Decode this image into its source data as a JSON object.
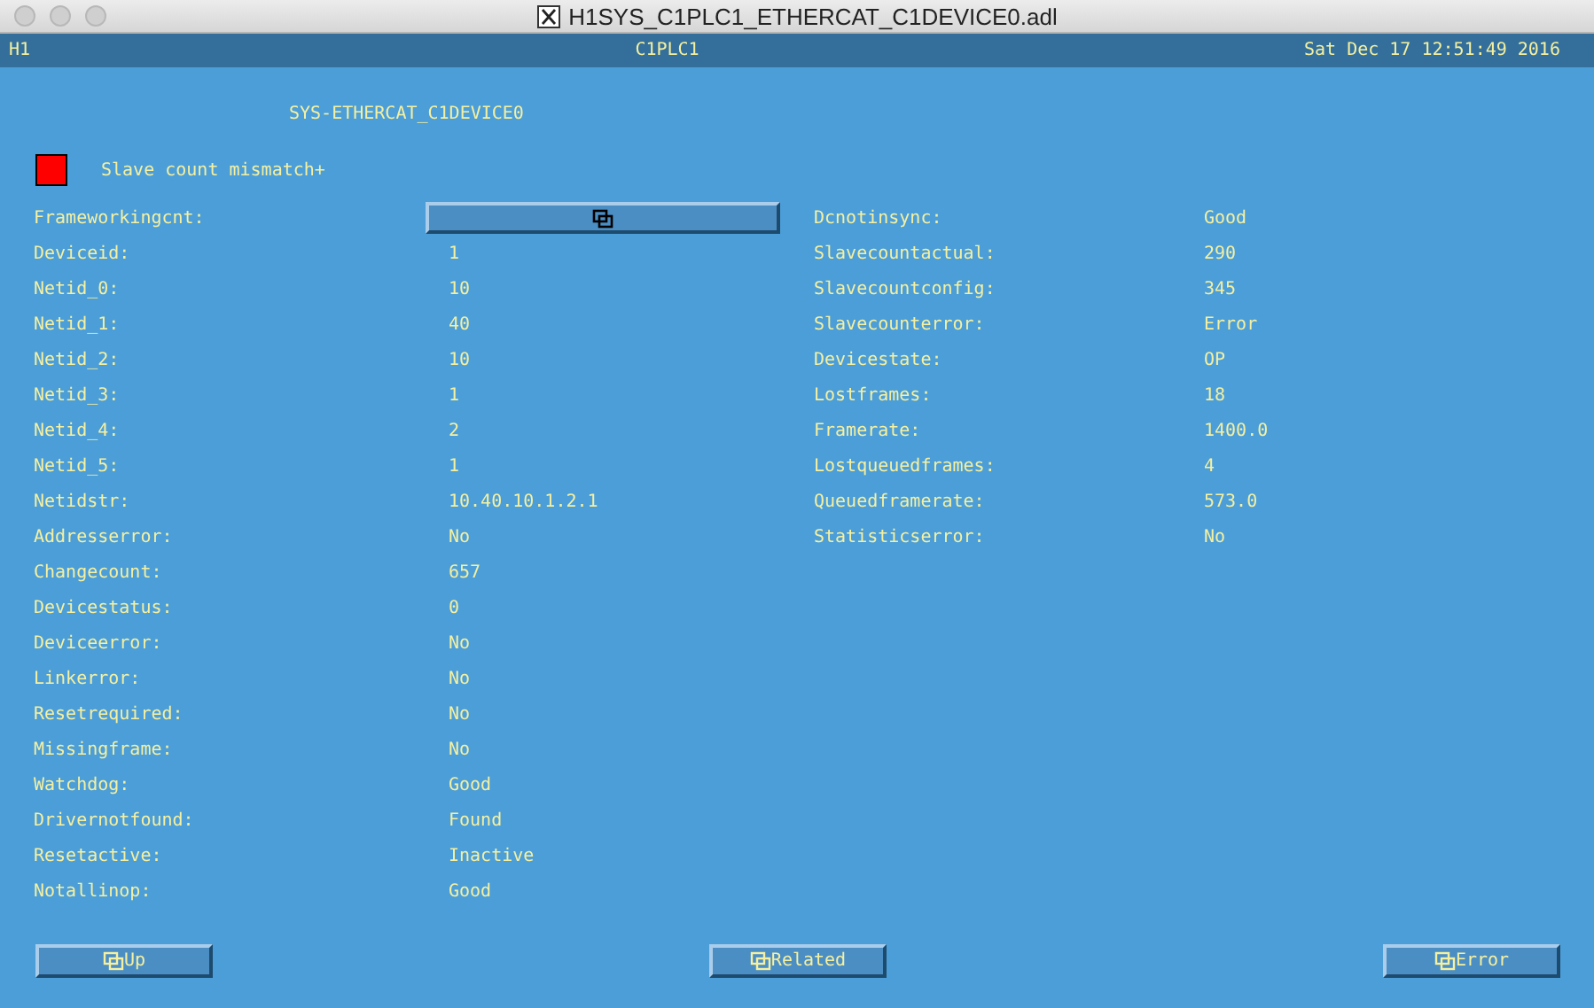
{
  "window": {
    "title": "H1SYS_C1PLC1_ETHERCAT_C1DEVICE0.adl"
  },
  "header": {
    "left": "H1",
    "center": "C1PLC1",
    "right": "Sat Dec 17 12:51:49 2016"
  },
  "screen_title": "SYS-ETHERCAT_C1DEVICE0",
  "alarm": {
    "color": "#ff0000",
    "text": "Slave count mismatch+"
  },
  "left_fields": [
    {
      "label": "Frameworkingcnt:",
      "kind": "button"
    },
    {
      "label": "Deviceid:",
      "value": "1",
      "kind": "text"
    },
    {
      "label": "Netid_0:",
      "value": "10",
      "kind": "text"
    },
    {
      "label": "Netid_1:",
      "value": "40",
      "kind": "text"
    },
    {
      "label": "Netid_2:",
      "value": "10",
      "kind": "text"
    },
    {
      "label": "Netid_3:",
      "value": "1",
      "kind": "text"
    },
    {
      "label": "Netid_4:",
      "value": "2",
      "kind": "text"
    },
    {
      "label": "Netid_5:",
      "value": "1",
      "kind": "text"
    },
    {
      "label": "Netidstr:",
      "value": "10.40.10.1.2.1",
      "kind": "text"
    },
    {
      "label": "Addresserror:",
      "value": "No",
      "kind": "text"
    },
    {
      "label": "Changecount:",
      "value": "657",
      "kind": "text"
    },
    {
      "label": "Devicestatus:",
      "value": "0",
      "kind": "text"
    },
    {
      "label": "Deviceerror:",
      "value": "No",
      "kind": "text"
    },
    {
      "label": "Linkerror:",
      "value": "No",
      "kind": "text"
    },
    {
      "label": "Resetrequired:",
      "value": "No",
      "kind": "text"
    },
    {
      "label": "Missingframe:",
      "value": "No",
      "kind": "text"
    },
    {
      "label": "Watchdog:",
      "value": "Good",
      "kind": "text"
    },
    {
      "label": "Drivernotfound:",
      "value": "Found",
      "kind": "text"
    },
    {
      "label": "Resetactive:",
      "value": "Inactive",
      "kind": "text"
    },
    {
      "label": "Notallinop:",
      "value": "Good",
      "kind": "text"
    }
  ],
  "right_fields": [
    {
      "label": "Dcnotinsync:",
      "value": "Good"
    },
    {
      "label": "Slavecountactual:",
      "value": "290"
    },
    {
      "label": "Slavecountconfig:",
      "value": "345"
    },
    {
      "label": "Slavecounterror:",
      "value": "Error"
    },
    {
      "label": "Devicestate:",
      "value": "OP"
    },
    {
      "label": "Lostframes:",
      "value": "18"
    },
    {
      "label": "Framerate:",
      "value": "1400.0"
    },
    {
      "label": "Lostqueuedframes:",
      "value": "4"
    },
    {
      "label": "Queuedframerate:",
      "value": "573.0"
    },
    {
      "label": "Statisticserror:",
      "value": "No"
    }
  ],
  "buttons": [
    {
      "label": "Up"
    },
    {
      "label": "Related"
    },
    {
      "label": "Error"
    }
  ]
}
